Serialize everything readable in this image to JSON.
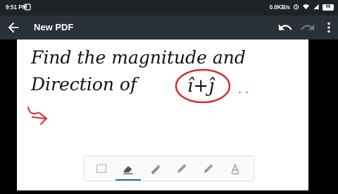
{
  "status_bar": {
    "time": "9:51 PM",
    "network_speed": "0.0KB/s",
    "battery_level": "98",
    "icons": [
      "alarm-icon",
      "wifi-icon",
      "sim-signal-icon",
      "battery-icon"
    ]
  },
  "app_bar": {
    "title": "New PDF",
    "icons": [
      "back-arrow-icon",
      "undo-icon",
      "redo-icon",
      "more-vert-icon"
    ]
  },
  "note": {
    "line1": "Find the magnitude and",
    "line2": "Direction of",
    "expression": "î+ĵ",
    "trailing": ". ."
  },
  "toolbar": {
    "tools": [
      "select-icon",
      "eraser-icon",
      "pen-icon",
      "pencil-icon",
      "marker-icon",
      "text-icon"
    ],
    "active_tool": "eraser-icon"
  },
  "colors": {
    "status_bar": "#1e2326",
    "app_bar": "#2a3137",
    "ink": "#111111",
    "annotation": "#d62a2a",
    "active_tool": "#2a63c7"
  }
}
